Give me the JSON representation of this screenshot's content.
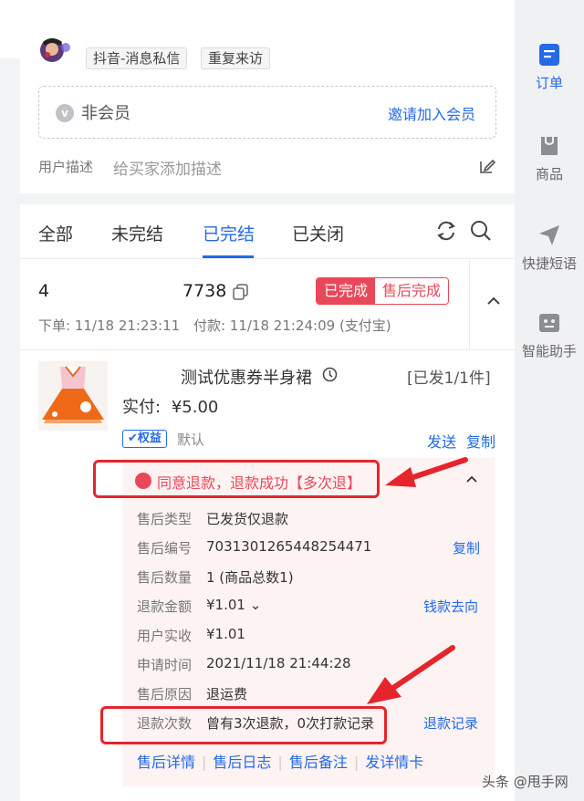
{
  "customer": {
    "source_tag": "抖音-消息私信",
    "visit_tag": "重复来访",
    "member_status": "非会员",
    "invite_link": "邀请加入会员",
    "desc_label": "用户描述",
    "desc_placeholder": "给买家添加描述"
  },
  "tabs": [
    {
      "label": "全部"
    },
    {
      "label": "未完结"
    },
    {
      "label": "已完结",
      "active": true
    },
    {
      "label": "已关闭"
    }
  ],
  "order": {
    "id_prefix": "4",
    "id_suffix": "7738",
    "status": "已完成",
    "after_sale_status": "售后完成",
    "order_time": "下单: 11/18 21:23:11",
    "pay_time": "付款: 11/18 21:24:09",
    "pay_method": "(支付宝)",
    "product": {
      "title": "测试优惠券半身裙",
      "shipped": "[已发1/1件]",
      "paid_label": "实付:",
      "paid_amount": "¥5.00",
      "badge": "权益",
      "sku": "默认",
      "action_send": "发送",
      "action_copy": "复制"
    }
  },
  "refund": {
    "headline": "同意退款，退款成功【多次退】",
    "rows": [
      {
        "k": "售后类型",
        "v": "已发货仅退款"
      },
      {
        "k": "售后编号",
        "v": "7031301265448254471",
        "action": "复制"
      },
      {
        "k": "售后数量",
        "v": "1 (商品总数1)"
      },
      {
        "k": "退款金额",
        "v": "¥1.01 ⌄",
        "action": "钱款去向"
      },
      {
        "k": "用户实收",
        "v": "¥1.01"
      },
      {
        "k": "申请时间",
        "v": "2021/11/18 21:44:28"
      },
      {
        "k": "售后原因",
        "v": "退运费"
      },
      {
        "k": "退款次数",
        "v": "曾有3次退款，0次打款记录",
        "action": "退款记录"
      }
    ],
    "links": [
      "售后详情",
      "售后日志",
      "售后备注",
      "发详情卡"
    ]
  },
  "sidebar": [
    {
      "label": "订单",
      "icon": "order-icon",
      "active": true
    },
    {
      "label": "商品",
      "icon": "bag-icon"
    },
    {
      "label": "快捷短语",
      "icon": "send-icon"
    },
    {
      "label": "智能助手",
      "icon": "robot-icon"
    }
  ],
  "watermark": "头条 @甩手网",
  "colors": {
    "accent": "#2469e6",
    "danger": "#e8495a",
    "annotation": "#e5252b"
  }
}
